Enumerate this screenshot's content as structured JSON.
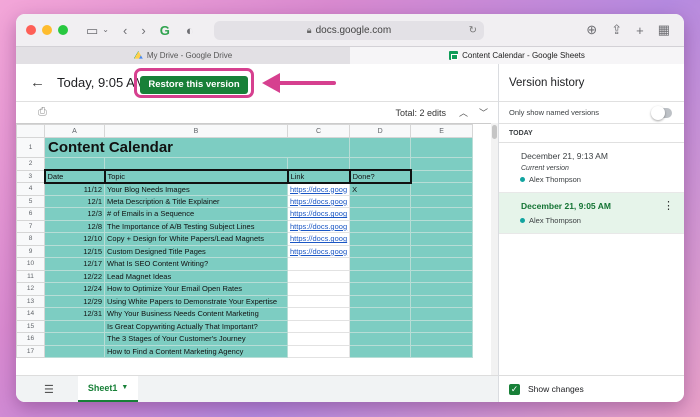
{
  "browser": {
    "url": "docs.google.com",
    "tabs": [
      {
        "label": "My Drive - Google Drive",
        "active": false
      },
      {
        "label": "Content Calendar - Google Sheets",
        "active": true
      }
    ]
  },
  "header": {
    "title": "Today, 9:05 AM",
    "restore_label": "Restore this version"
  },
  "subbar": {
    "total_edits": "Total: 2 edits"
  },
  "grid": {
    "columns": [
      "A",
      "B",
      "C",
      "D",
      "E"
    ],
    "title": "Content Calendar",
    "header_row": [
      "Date",
      "Topic",
      "Link",
      "Done?"
    ],
    "rows": [
      {
        "n": "4",
        "date": "11/12",
        "topic": "Your Blog Needs Images",
        "link": "https://docs.goog",
        "done": "X"
      },
      {
        "n": "5",
        "date": "12/1",
        "topic": "Meta Description & Title Explainer",
        "link": "https://docs.goog",
        "done": ""
      },
      {
        "n": "6",
        "date": "12/3",
        "topic": "# of Emails in a Sequence",
        "link": "https://docs.goog",
        "done": ""
      },
      {
        "n": "7",
        "date": "12/8",
        "topic": "The Importance of A/B Testing Subject Lines",
        "link": "https://docs.goog",
        "done": ""
      },
      {
        "n": "8",
        "date": "12/10",
        "topic": "Copy + Design for White Papers/Lead Magnets",
        "link": "https://docs.goog",
        "done": ""
      },
      {
        "n": "9",
        "date": "12/15",
        "topic": "Custom Designed Title Pages",
        "link": "https://docs.goog",
        "done": ""
      },
      {
        "n": "10",
        "date": "12/17",
        "topic": "What Is SEO Content Writing?",
        "link": "",
        "done": ""
      },
      {
        "n": "11",
        "date": "12/22",
        "topic": "Lead Magnet Ideas",
        "link": "",
        "done": ""
      },
      {
        "n": "12",
        "date": "12/24",
        "topic": "How to Optimize Your Email Open Rates",
        "link": "",
        "done": ""
      },
      {
        "n": "13",
        "date": "12/29",
        "topic": "Using White Papers to Demonstrate Your Expertise",
        "link": "",
        "done": ""
      },
      {
        "n": "14",
        "date": "12/31",
        "topic": "Why Your Business Needs Content Marketing",
        "link": "",
        "done": ""
      },
      {
        "n": "15",
        "date": "",
        "topic": "Is Great Copywriting Actually That Important?",
        "link": "",
        "done": ""
      },
      {
        "n": "16",
        "date": "",
        "topic": "The 3 Stages of Your Customer's Journey",
        "link": "",
        "done": ""
      },
      {
        "n": "17",
        "date": "",
        "topic": "How to Find a Content Marketing Agency",
        "link": "",
        "done": ""
      }
    ]
  },
  "sheet_tab": {
    "label": "Sheet1"
  },
  "panel": {
    "title": "Version history",
    "named_label": "Only show named versions",
    "section": "TODAY",
    "versions": [
      {
        "time": "December 21, 9:13 AM",
        "sub": "Current version",
        "user": "Alex Thompson"
      },
      {
        "time": "December 21, 9:05 AM",
        "sub": "",
        "user": "Alex Thompson"
      }
    ],
    "show_changes": "Show changes"
  },
  "colors": {
    "accent_green": "#188038",
    "highlight_pink": "#d6408f",
    "cell_teal": "#7dcdc2"
  }
}
